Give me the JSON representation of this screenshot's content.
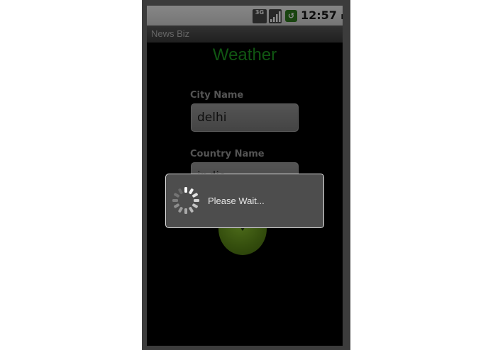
{
  "status_bar": {
    "network": "3G",
    "time": "12:57",
    "ampm": "PM"
  },
  "app_title": "News Biz",
  "screen": {
    "heading": "Weather",
    "city_label": "City Name",
    "city_value": "delhi",
    "country_label": "Country Name",
    "country_value": "india"
  },
  "dialog": {
    "message": "Please Wait..."
  },
  "colors": {
    "heading": "#1e9d22",
    "label": "#9a9a9a",
    "button": "#7ab82a"
  },
  "icons": [
    "3g-icon",
    "signal-icon",
    "app-notification-icon",
    "go-arrow-icon",
    "spinner-icon"
  ]
}
